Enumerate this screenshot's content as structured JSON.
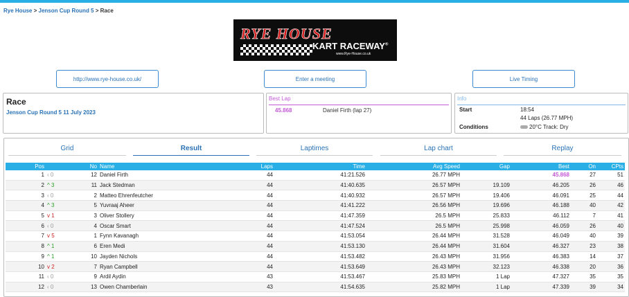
{
  "breadcrumb": {
    "home": "Rye House",
    "event": "Jenson Cup Round 5",
    "current": "Race",
    "sep": ">"
  },
  "logo": {
    "line1": "RYE HOUSE",
    "line2": "KART RACEWAY",
    "reg": "®",
    "url": "www.Rye-House.co.uk"
  },
  "buttons": {
    "website": "http://www.rye-house.co.uk/",
    "enter": "Enter a meeting",
    "live": "Live Timing"
  },
  "race": {
    "title": "Race",
    "subtitle": "Jenson Cup Round 5 11 July 2023"
  },
  "best_lap": {
    "header": "Best Lap",
    "time": "45.868",
    "driver": "Daniel Firth (lap 27)"
  },
  "info": {
    "header": "Info",
    "start_label": "Start",
    "start_time": "18:54",
    "laps": "44 Laps (26.77 MPH)",
    "conditions_label": "Conditions",
    "conditions": "20°C Track: Dry"
  },
  "tabs": [
    "Grid",
    "Result",
    "Laptimes",
    "Lap chart",
    "Replay"
  ],
  "table": {
    "headers": [
      "Pos",
      "",
      "No",
      "Name",
      "Laps",
      "Time",
      "Avg Speed",
      "Gap",
      "Best",
      "On",
      "CPts"
    ],
    "rows": [
      {
        "pos": "1",
        "arrow": "‹",
        "chg": "0",
        "dir": "same",
        "no": "12",
        "name": "Daniel Firth",
        "laps": "44",
        "time": "41:21.526",
        "speed": "26.77 MPH",
        "gap": "",
        "best": "45.868",
        "on": "27",
        "cpts": "51"
      },
      {
        "pos": "2",
        "arrow": "^",
        "chg": "3",
        "dir": "up",
        "no": "11",
        "name": "Jack Stedman",
        "laps": "44",
        "time": "41:40.635",
        "speed": "26.57 MPH",
        "gap": "19.109",
        "best": "46.205",
        "on": "26",
        "cpts": "46"
      },
      {
        "pos": "3",
        "arrow": "‹",
        "chg": "0",
        "dir": "same",
        "no": "2",
        "name": "Matteo Ehrenfeutcher",
        "laps": "44",
        "time": "41:40.932",
        "speed": "26.57 MPH",
        "gap": "19.406",
        "best": "46.091",
        "on": "25",
        "cpts": "44"
      },
      {
        "pos": "4",
        "arrow": "^",
        "chg": "3",
        "dir": "up",
        "no": "5",
        "name": "Yuvraaj Aheer",
        "laps": "44",
        "time": "41:41.222",
        "speed": "26.56 MPH",
        "gap": "19.696",
        "best": "46.188",
        "on": "40",
        "cpts": "42"
      },
      {
        "pos": "5",
        "arrow": "v",
        "chg": "1",
        "dir": "down",
        "no": "3",
        "name": "Oliver Stollery",
        "laps": "44",
        "time": "41:47.359",
        "speed": "26.5 MPH",
        "gap": "25.833",
        "best": "46.112",
        "on": "7",
        "cpts": "41"
      },
      {
        "pos": "6",
        "arrow": "‹",
        "chg": "0",
        "dir": "same",
        "no": "4",
        "name": "Oscar Smart",
        "laps": "44",
        "time": "41:47.524",
        "speed": "26.5 MPH",
        "gap": "25.998",
        "best": "46.059",
        "on": "26",
        "cpts": "40"
      },
      {
        "pos": "7",
        "arrow": "v",
        "chg": "5",
        "dir": "down",
        "no": "1",
        "name": "Fynn Kavanagh",
        "laps": "44",
        "time": "41:53.054",
        "speed": "26.44 MPH",
        "gap": "31.528",
        "best": "46.049",
        "on": "40",
        "cpts": "39"
      },
      {
        "pos": "8",
        "arrow": "^",
        "chg": "1",
        "dir": "up",
        "no": "6",
        "name": "Eren Medi",
        "laps": "44",
        "time": "41:53.130",
        "speed": "26.44 MPH",
        "gap": "31.604",
        "best": "46.327",
        "on": "23",
        "cpts": "38"
      },
      {
        "pos": "9",
        "arrow": "^",
        "chg": "1",
        "dir": "up",
        "no": "10",
        "name": "Jayden Nichols",
        "laps": "44",
        "time": "41:53.482",
        "speed": "26.43 MPH",
        "gap": "31.956",
        "best": "46.383",
        "on": "14",
        "cpts": "37"
      },
      {
        "pos": "10",
        "arrow": "v",
        "chg": "2",
        "dir": "down",
        "no": "7",
        "name": "Ryan Campbell",
        "laps": "44",
        "time": "41:53.649",
        "speed": "26.43 MPH",
        "gap": "32.123",
        "best": "46.338",
        "on": "20",
        "cpts": "36"
      },
      {
        "pos": "11",
        "arrow": "‹",
        "chg": "0",
        "dir": "same",
        "no": "9",
        "name": "Ardil Aydin",
        "laps": "43",
        "time": "41:53.467",
        "speed": "25.83 MPH",
        "gap": "1 Lap",
        "best": "47.327",
        "on": "35",
        "cpts": "35"
      },
      {
        "pos": "12",
        "arrow": "‹",
        "chg": "0",
        "dir": "same",
        "no": "13",
        "name": "Owen Chamberlain",
        "laps": "43",
        "time": "41:54.635",
        "speed": "25.82 MPH",
        "gap": "1 Lap",
        "best": "47.339",
        "on": "39",
        "cpts": "34"
      }
    ]
  },
  "colors": {
    "accent": "#29aee6",
    "link": "#2a72b5",
    "best": "#c45ad8",
    "up": "#2aa02a",
    "down": "#d02020"
  }
}
